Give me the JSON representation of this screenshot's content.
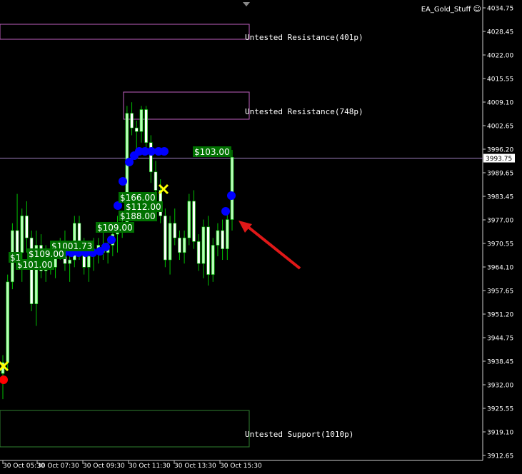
{
  "window": {
    "title": "EA_Gold_Stuff"
  },
  "current_price": "3993.75",
  "y_ticks": [
    "4034.75",
    "4028.45",
    "4022.00",
    "4015.55",
    "4009.10",
    "4002.65",
    "3996.20",
    "3989.65",
    "3983.45",
    "3977.00",
    "3970.55",
    "3964.10",
    "3957.65",
    "3951.20",
    "3944.75",
    "3938.45",
    "3932.00",
    "3925.55",
    "3919.10",
    "3912.65"
  ],
  "x_ticks": [
    "30 Oct 05:30",
    "30 Oct 07:30",
    "30 Oct 09:30",
    "30 Oct 11:30",
    "30 Oct 13:30",
    "30 Oct 15:30"
  ],
  "zones": [
    {
      "label": "Untested Resistance(401p)",
      "kind": "resistance"
    },
    {
      "label": "Untested Resistance(748p)",
      "kind": "resistance"
    },
    {
      "label": "Untested Support(1010p)",
      "kind": "support"
    }
  ],
  "trade_labels": [
    {
      "text": "$103.00"
    },
    {
      "text": "$166.00"
    },
    {
      "text": "$112.00"
    },
    {
      "text": "$188.00"
    },
    {
      "text": "$109.00"
    },
    {
      "text": "$1001.73"
    },
    {
      "text": "$109.00"
    },
    {
      "text": "$101.00"
    },
    {
      "text": "$1"
    }
  ],
  "colors": {
    "background": "#000000",
    "bull": "#b8ffb8",
    "bear": "#ffffff",
    "wick": "#00c000",
    "resistance": "#c060c0",
    "support": "#308030",
    "label_bg": "#007000",
    "price_line": "#a080c0",
    "dots": "#0000ff",
    "arrow": "#e01818",
    "cross": "#ffff00",
    "red_dot": "#ff0000"
  },
  "chart_data": {
    "type": "candlestick",
    "x_ticks": [
      "30 Oct 05:30",
      "30 Oct 07:30",
      "30 Oct 09:30",
      "30 Oct 11:30",
      "30 Oct 13:30",
      "30 Oct 15:30"
    ],
    "ylim": [
      3912.65,
      4034.75
    ],
    "last_price": 3993.75,
    "candles": [
      [
        3935,
        3940,
        3928,
        3938
      ],
      [
        3938,
        3962,
        3936,
        3960
      ],
      [
        3960,
        3976,
        3958,
        3974
      ],
      [
        3974,
        3984,
        3966,
        3968
      ],
      [
        3968,
        3980,
        3960,
        3978
      ],
      [
        3978,
        3982,
        3968,
        3972
      ],
      [
        3972,
        3974,
        3952,
        3954
      ],
      [
        3954,
        3974,
        3948,
        3970
      ],
      [
        3970,
        3973,
        3961,
        3963
      ],
      [
        3963,
        3970,
        3960,
        3967
      ],
      [
        3967,
        3971,
        3962,
        3964
      ],
      [
        3964,
        3969,
        3961,
        3968
      ],
      [
        3968,
        3972,
        3966,
        3970
      ],
      [
        3970,
        3974,
        3963,
        3965
      ],
      [
        3965,
        3968,
        3960,
        3966
      ],
      [
        3966,
        3978,
        3964,
        3976
      ],
      [
        3976,
        3978,
        3966,
        3970
      ],
      [
        3970,
        3972,
        3962,
        3964
      ],
      [
        3964,
        3968,
        3960,
        3967
      ],
      [
        3967,
        3972,
        3963,
        3969
      ],
      [
        3969,
        3972,
        3965,
        3970
      ],
      [
        3970,
        3975,
        3966,
        3968
      ],
      [
        3968,
        3972,
        3965,
        3970
      ],
      [
        3970,
        3975,
        3967,
        3973
      ],
      [
        3973,
        3978,
        3968,
        3975
      ],
      [
        3975,
        3978,
        3972,
        3976
      ],
      [
        3976,
        4008,
        3974,
        4006
      ],
      [
        4006,
        4009,
        4000,
        4002
      ],
      [
        4002,
        4004,
        3996,
        4001
      ],
      [
        4001,
        4008,
        3998,
        4007
      ],
      [
        4007,
        4008,
        3996,
        3998
      ],
      [
        3998,
        4000,
        3987,
        3990
      ],
      [
        3990,
        3993,
        3983,
        3985
      ],
      [
        3985,
        3988,
        3976,
        3978
      ],
      [
        3978,
        3980,
        3964,
        3966
      ],
      [
        3966,
        3978,
        3962,
        3976
      ],
      [
        3976,
        3980,
        3970,
        3972
      ],
      [
        3972,
        3974,
        3966,
        3968
      ],
      [
        3968,
        3974,
        3965,
        3972
      ],
      [
        3972,
        3984,
        3970,
        3982
      ],
      [
        3982,
        3985,
        3969,
        3971
      ],
      [
        3971,
        3973,
        3963,
        3965
      ],
      [
        3965,
        3977,
        3961,
        3975
      ],
      [
        3975,
        3978,
        3959,
        3962
      ],
      [
        3962,
        3972,
        3960,
        3970
      ],
      [
        3970,
        3976,
        3967,
        3974
      ],
      [
        3974,
        3977,
        3966,
        3969
      ],
      [
        3969,
        3980,
        3966,
        3977
      ],
      [
        3977,
        3996,
        3974,
        3994
      ]
    ]
  }
}
